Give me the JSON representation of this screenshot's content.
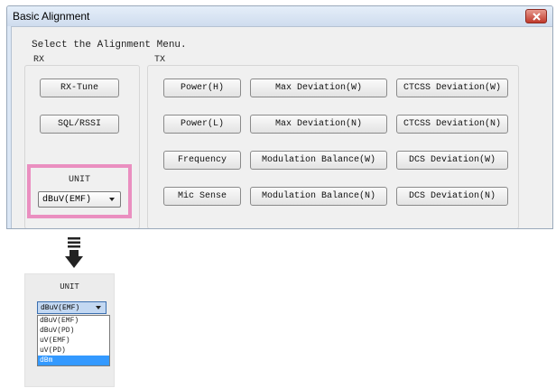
{
  "window": {
    "title": "Basic Alignment",
    "close_icon": "close-icon"
  },
  "prompt": "Select the Alignment Menu.",
  "rx": {
    "label": "RX",
    "buttons": [
      "RX-Tune",
      "SQL/RSSI"
    ]
  },
  "tx": {
    "label": "TX",
    "rows": [
      [
        "Power(H)",
        "Max Deviation(W)",
        "CTCSS Deviation(W)"
      ],
      [
        "Power(L)",
        "Max Deviation(N)",
        "CTCSS Deviation(N)"
      ],
      [
        "Frequency",
        "Modulation Balance(W)",
        "DCS Deviation(W)"
      ],
      [
        "Mic Sense",
        "Modulation Balance(N)",
        "DCS Deviation(N)"
      ]
    ]
  },
  "unit": {
    "label": "UNIT",
    "selected": "dBuV(EMF)",
    "options": [
      "dBuV(EMF)",
      "dBuV(PD)",
      "uV(EMF)",
      "uV(PD)",
      "dBm"
    ],
    "highlighted": "dBm"
  },
  "colors": {
    "highlight_border": "#ea8fc0",
    "dropdown_selection": "#3399ff"
  }
}
